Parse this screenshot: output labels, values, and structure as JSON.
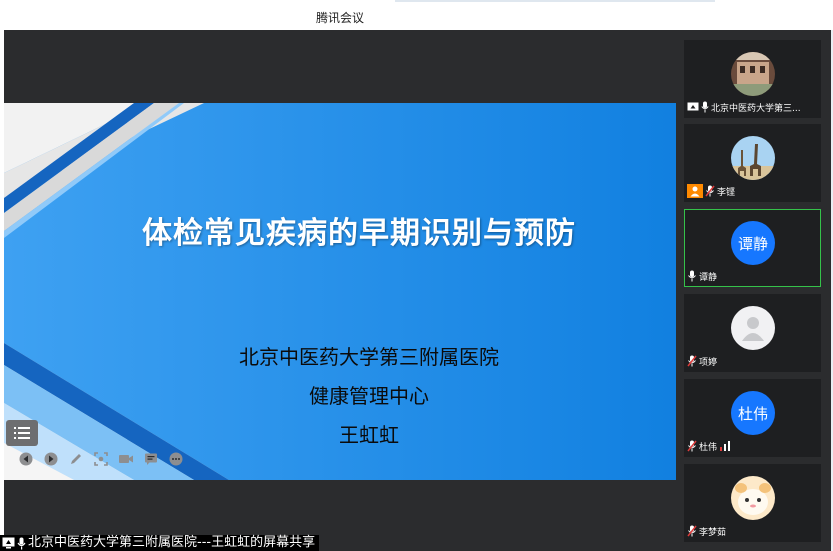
{
  "window": {
    "title": "腾讯会议"
  },
  "slide": {
    "title": "体检常见疾病的早期识别与预防",
    "institution": "北京中医药大学第三附属医院",
    "department": "健康管理中心",
    "presenter": "王虹虹"
  },
  "share_caption": "北京中医药大学第三附属医院---王虹虹的屏幕共享",
  "participants": [
    {
      "name": "北京中医药大学第三...",
      "avatar": "building-photo"
    },
    {
      "name": "李铿",
      "avatar": "giraffe-photo"
    },
    {
      "name": "谭静",
      "avatar_text": "谭静"
    },
    {
      "name": "项婷",
      "avatar": "default-person"
    },
    {
      "name": "杜伟",
      "avatar_text": "杜伟"
    },
    {
      "name": "李梦茹",
      "avatar": "cartoon-photo"
    }
  ],
  "colors": {
    "slide_blue": "#1e88e5",
    "panel_bg": "#2b2c2e",
    "tile_bg": "#1e1f21",
    "avatar_blue": "#1677ff",
    "speaking_green": "#35c24a",
    "muted_red": "#e03b3b"
  }
}
